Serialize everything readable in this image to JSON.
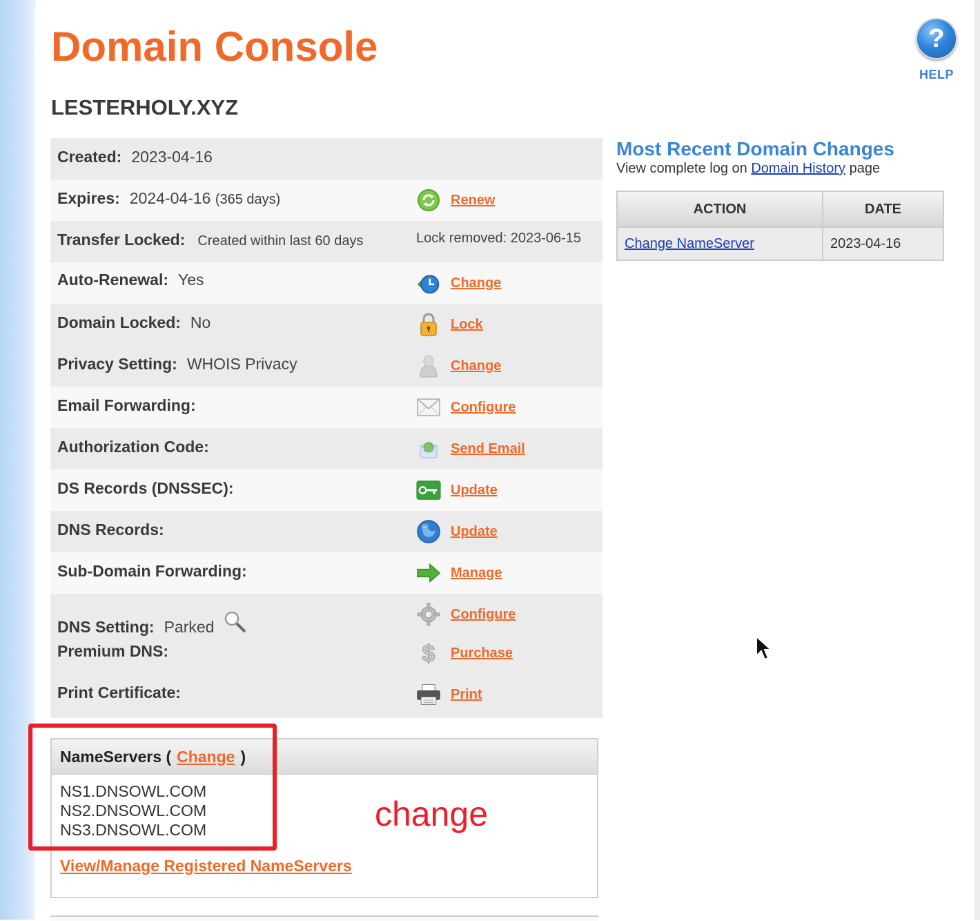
{
  "page": {
    "title": "Domain Console",
    "domain": "LESTERHOLY.XYZ",
    "help_label": "HELP",
    "help_glyph": "?"
  },
  "details": {
    "created": {
      "label": "Created:",
      "value": "2023-04-16"
    },
    "expires": {
      "label": "Expires:",
      "value": "2024-04-16",
      "days": "(365 days)",
      "action": "Renew",
      "icon": "renew-icon"
    },
    "transfer": {
      "label": "Transfer Locked:",
      "value": "Created within last 60 days",
      "note": "Lock removed: 2023-06-15"
    },
    "auto_renewal": {
      "label": "Auto-Renewal:",
      "value": "Yes",
      "action": "Change",
      "icon": "clock-icon"
    },
    "domain_locked": {
      "label": "Domain Locked:",
      "value": "No",
      "action": "Lock",
      "icon": "padlock-icon"
    },
    "privacy": {
      "label": "Privacy Setting:",
      "value": "WHOIS Privacy",
      "action": "Change",
      "icon": "user-silhouette-icon"
    },
    "email_forwarding": {
      "label": "Email Forwarding:",
      "action": "Configure",
      "icon": "envelope-icon"
    },
    "auth_code": {
      "label": "Authorization Code:",
      "action": "Send Email",
      "icon": "mail-send-icon"
    },
    "ds_records": {
      "label": "DS Records (DNSSEC):",
      "action": "Update",
      "icon": "key-icon"
    },
    "dns_records": {
      "label": "DNS Records:",
      "action": "Update",
      "icon": "globe-icon"
    },
    "subdomain": {
      "label": "Sub-Domain Forwarding:",
      "action": "Manage",
      "icon": "arrow-right-icon"
    },
    "dns_setting": {
      "label": "DNS Setting:",
      "value": "Parked",
      "action": "Configure",
      "icon": "gear-icon"
    },
    "premium_dns": {
      "label": "Premium DNS:",
      "action": "Purchase",
      "icon": "dollar-icon"
    },
    "print_cert": {
      "label": "Print Certificate:",
      "action": "Print",
      "icon": "printer-icon"
    }
  },
  "nameservers": {
    "heading": "NameServers (",
    "heading_close": ")",
    "change_label": "Change",
    "list": [
      "NS1.DNSOWL.COM",
      "NS2.DNSOWL.COM",
      "NS3.DNSOWL.COM"
    ],
    "manage_link": "View/Manage Registered NameServers"
  },
  "annotation": {
    "text": "change",
    "color": "#e8202a"
  },
  "recent_changes": {
    "title": "Most Recent Domain Changes",
    "sub_prefix": "View complete log on",
    "sub_link": "Domain History",
    "sub_suffix": "page",
    "columns": [
      "ACTION",
      "DATE"
    ],
    "rows": [
      {
        "action": "Change NameServer",
        "date": "2023-04-16"
      }
    ]
  },
  "colors": {
    "accent": "#ef6a2a",
    "link_blue": "#1a3fb5",
    "heading_blue": "#3a86d4"
  }
}
